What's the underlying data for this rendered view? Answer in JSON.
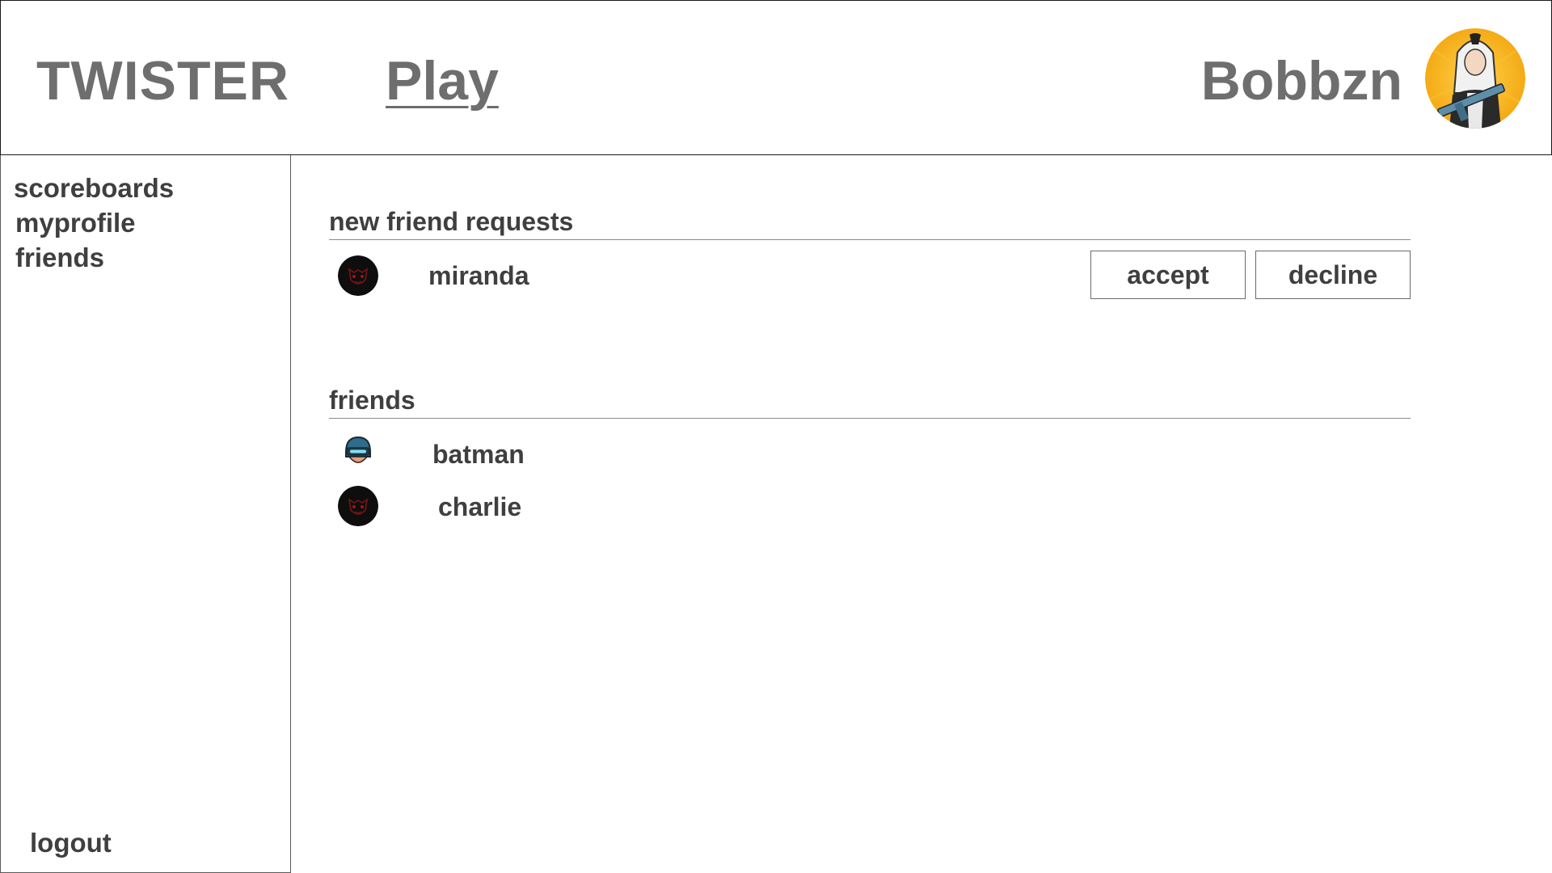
{
  "header": {
    "brand": "TWISTER",
    "play_label": "Play",
    "username": "Bobbzn",
    "avatar_icon": "user-avatar-icon"
  },
  "sidebar": {
    "items": [
      {
        "label": "scoreboards"
      },
      {
        "label": "myprofile"
      },
      {
        "label": "friends"
      }
    ],
    "logout_label": "logout"
  },
  "requests": {
    "title": "new friend requests",
    "items": [
      {
        "name": "miranda",
        "avatar_icon": "dark-mask-avatar-icon"
      }
    ],
    "accept_label": "accept",
    "decline_label": "decline"
  },
  "friends": {
    "title": "friends",
    "items": [
      {
        "name": "batman",
        "avatar_icon": "helmet-avatar-icon"
      },
      {
        "name": "charlie",
        "avatar_icon": "dark-mask-avatar-icon"
      }
    ]
  },
  "colors": {
    "text_dark": "#3f3f3f",
    "text_header": "#6e6e6e",
    "border": "#1a1a1a",
    "avatar_bg": "#f5b017"
  }
}
